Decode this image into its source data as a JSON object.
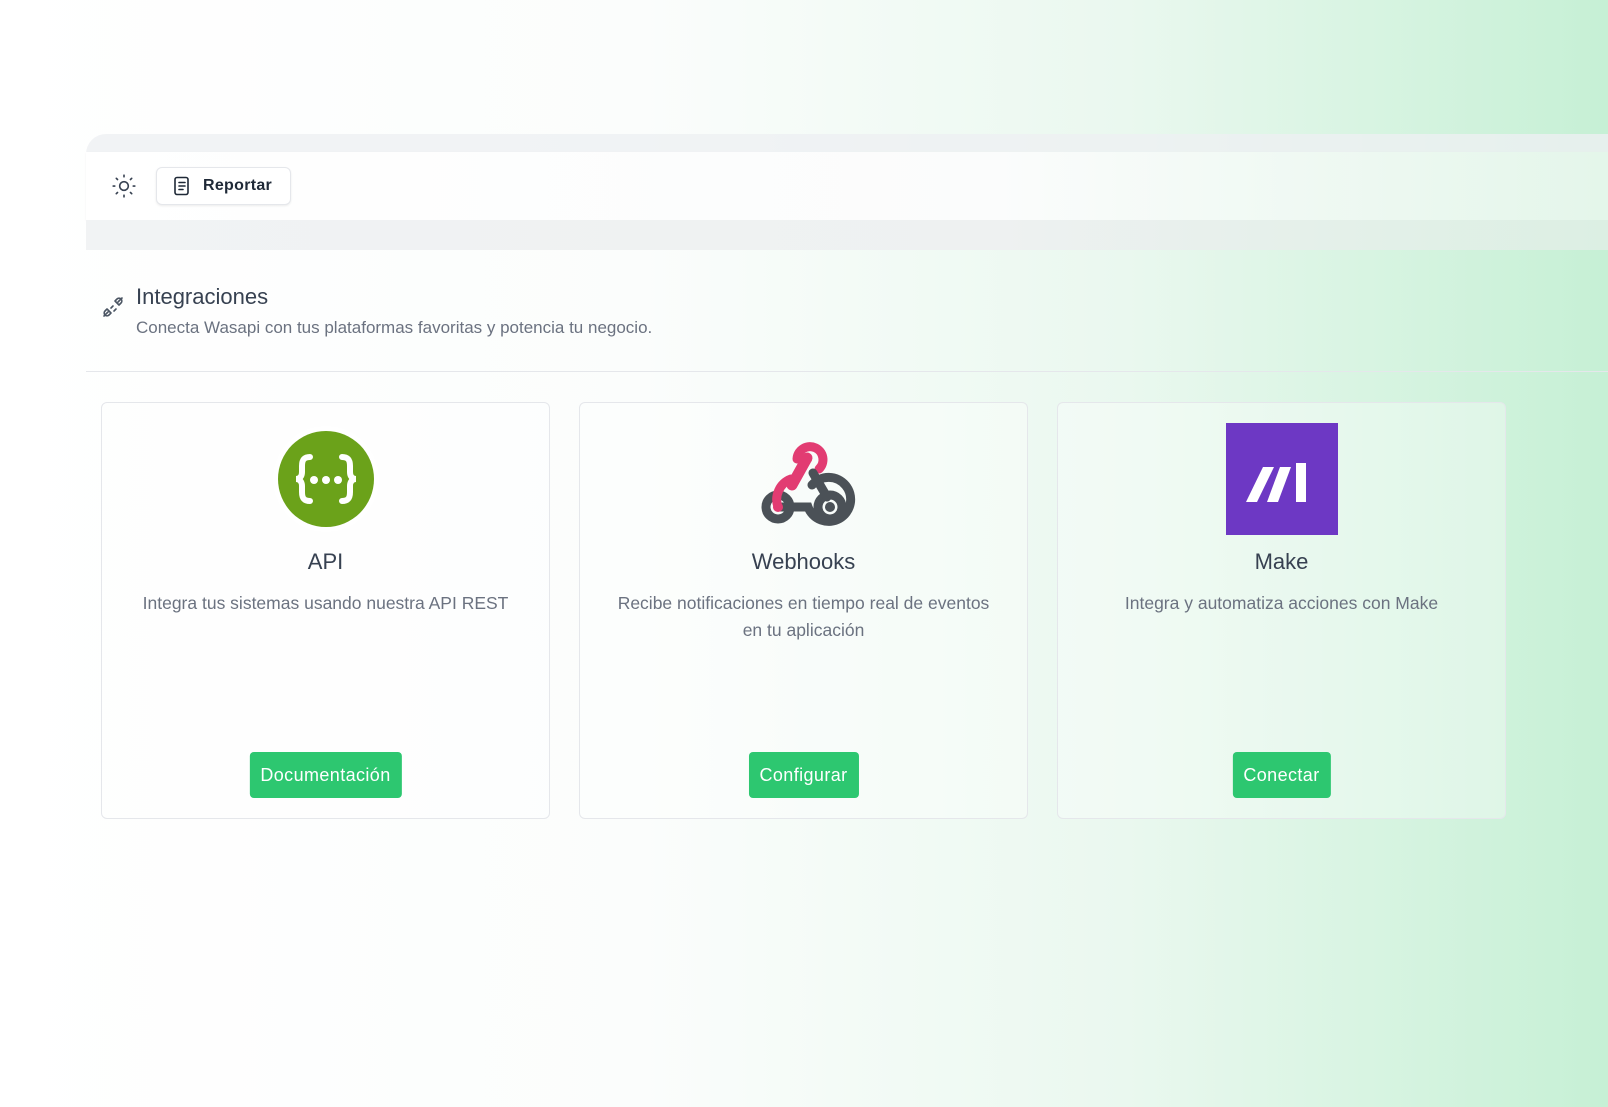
{
  "toolbar": {
    "theme_icon": "sun-icon",
    "report_icon": "document-icon",
    "report_label": "Reportar"
  },
  "section": {
    "icon": "plug-icon",
    "title": "Integraciones",
    "subtitle": "Conecta Wasapi con tus plataformas favoritas y potencia tu negocio."
  },
  "integrations": [
    {
      "name": "API",
      "description": "Integra tus sistemas usando nuestra API REST",
      "button": "Documentación",
      "logo": "swagger-logo",
      "logo_color": "#6ba21a"
    },
    {
      "name": "Webhooks",
      "description": "Recibe notificaciones en tiempo real de eventos en tu aplicación",
      "button": "Configurar",
      "logo": "webhooks-logo",
      "logo_colors": [
        "#e23c72",
        "#4b5157"
      ]
    },
    {
      "name": "Make",
      "description": "Integra y automatiza acciones con Make",
      "button": "Conectar",
      "logo": "make-logo",
      "logo_color": "#6d38c4"
    }
  ],
  "colors": {
    "accent": "#2dc770",
    "gradient_end": "#c6f0d5"
  }
}
